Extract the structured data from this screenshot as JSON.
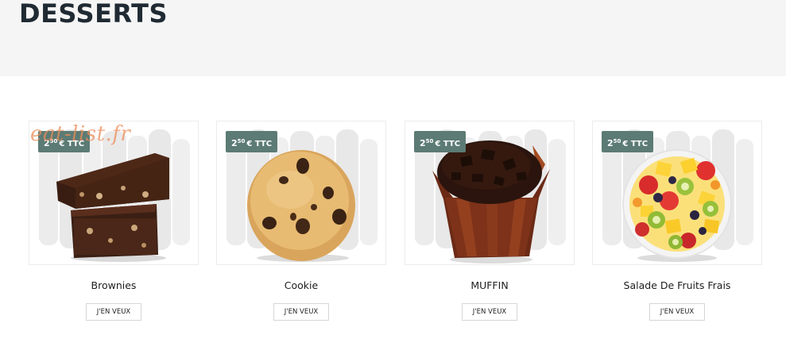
{
  "page": {
    "title": "DESSERTS",
    "watermark": "eat-list.fr"
  },
  "theme": {
    "price_badge_color": "#5c7b74",
    "hero_background": "#f5f5f5"
  },
  "products": [
    {
      "name": "Brownies",
      "price_int": "2",
      "price_dec": "50",
      "price_suffix": "€ TTC",
      "button_label": "J'EN VEUX",
      "image": "brownies-image"
    },
    {
      "name": "Cookie",
      "price_int": "2",
      "price_dec": "50",
      "price_suffix": "€ TTC",
      "button_label": "J'EN VEUX",
      "image": "cookie-image"
    },
    {
      "name": "MUFFIN",
      "price_int": "2",
      "price_dec": "50",
      "price_suffix": "€ TTC",
      "button_label": "J'EN VEUX",
      "image": "muffin-image"
    },
    {
      "name": "Salade De Fruits Frais",
      "price_int": "2",
      "price_dec": "50",
      "price_suffix": "€ TTC",
      "button_label": "J'EN VEUX",
      "image": "fruit-salad-image"
    }
  ]
}
